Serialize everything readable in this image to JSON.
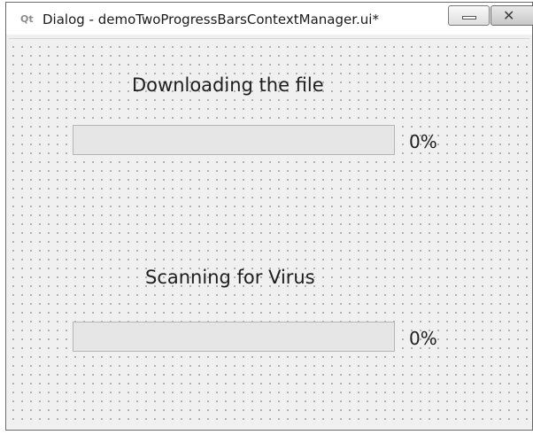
{
  "window": {
    "title": "Dialog - demoTwoProgressBarsContextManager.ui*",
    "app_icon": "qt-icon",
    "minimize_glyph": "minimize-icon",
    "close_glyph": "✕"
  },
  "dialog": {
    "download_label": "Downloading the file",
    "download_progress": {
      "value": 0,
      "text": "0%"
    },
    "scan_label": "Scanning for Virus",
    "scan_progress": {
      "value": 0,
      "text": "0%"
    }
  },
  "colors": {
    "background": "#f0f0f0",
    "progress_track": "#e6e6e6",
    "progress_fill": "#06b025"
  }
}
